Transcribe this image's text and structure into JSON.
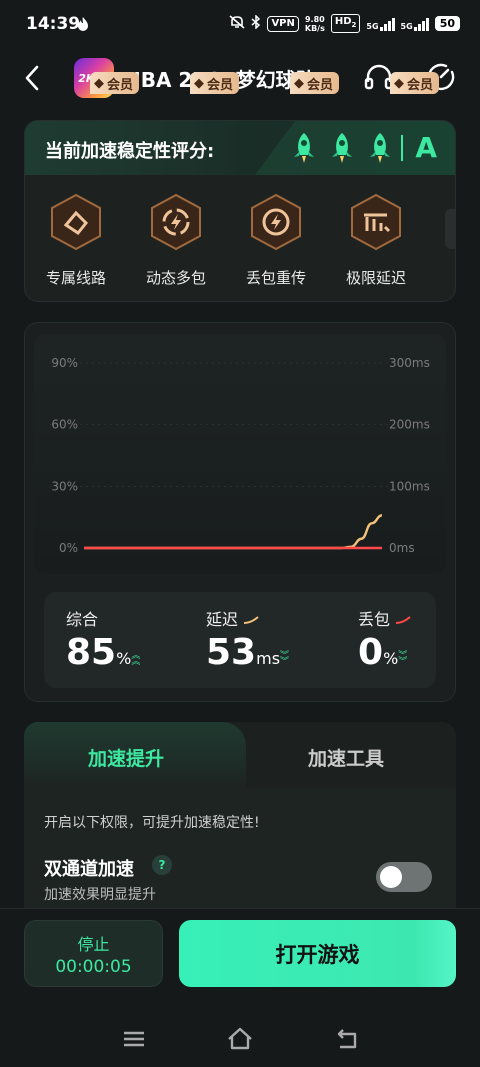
{
  "status": {
    "time": "14:39",
    "net_speed_value": "9.80",
    "net_speed_unit": "KB/s",
    "vpn": "VPN",
    "hd": "HD",
    "hd_sub": "2",
    "sig1": "5G",
    "sig2": "5G",
    "battery": "50"
  },
  "header": {
    "app_title": "NBA 2K24梦幻球队",
    "app_icon_text": "2K24"
  },
  "rating": {
    "label": "当前加速稳定性评分:",
    "grade": "A"
  },
  "features": [
    {
      "label": "专属线路",
      "badge": "会员"
    },
    {
      "label": "动态多包",
      "badge": "会员"
    },
    {
      "label": "丢包重传",
      "badge": "会员"
    },
    {
      "label": "极限延迟",
      "badge": "会员"
    }
  ],
  "chart_data": {
    "type": "line",
    "y_left_ticks": [
      "90%",
      "60%",
      "30%",
      "0%"
    ],
    "y_right_ticks": [
      "300ms",
      "200ms",
      "100ms",
      "0ms"
    ],
    "ylim_left": [
      0,
      90
    ],
    "ylim_right": [
      0,
      300
    ],
    "series": [
      {
        "name": "延迟",
        "axis": "right",
        "color": "#f2c07a",
        "values": [
          0,
          0,
          0,
          0,
          0,
          0,
          0,
          0,
          0,
          0,
          0,
          0,
          0,
          0,
          0,
          0,
          0,
          0,
          0,
          0,
          0,
          0,
          0,
          0,
          0,
          0,
          2,
          15,
          40,
          53
        ]
      },
      {
        "name": "丢包",
        "axis": "left",
        "color": "#ff4848",
        "values": [
          0,
          0,
          0,
          0,
          0,
          0,
          0,
          0,
          0,
          0,
          0,
          0,
          0,
          0,
          0,
          0,
          0,
          0,
          0,
          0,
          0,
          0,
          0,
          0,
          0,
          0,
          0,
          0,
          0,
          0
        ]
      }
    ]
  },
  "stats": {
    "overall": {
      "label": "综合",
      "value": "85",
      "unit": "%"
    },
    "latency": {
      "label": "延迟",
      "value": "53",
      "unit": "ms"
    },
    "loss": {
      "label": "丢包",
      "value": "0",
      "unit": "%"
    }
  },
  "tabs": {
    "active": "加速提升",
    "other": "加速工具"
  },
  "boost": {
    "hint": "开启以下权限，可提升加速稳定性!",
    "option_title": "双通道加速",
    "help": "?",
    "option_sub": "加速效果明显提升",
    "toggle_on": false
  },
  "bottom": {
    "stop_label": "停止",
    "elapsed": "00:00:05",
    "open_label": "打开游戏"
  },
  "colors": {
    "accent": "#3de8a0",
    "latency_line": "#f2c07a",
    "loss_line": "#ff4848",
    "vip_badge": "#f0cfa8"
  }
}
